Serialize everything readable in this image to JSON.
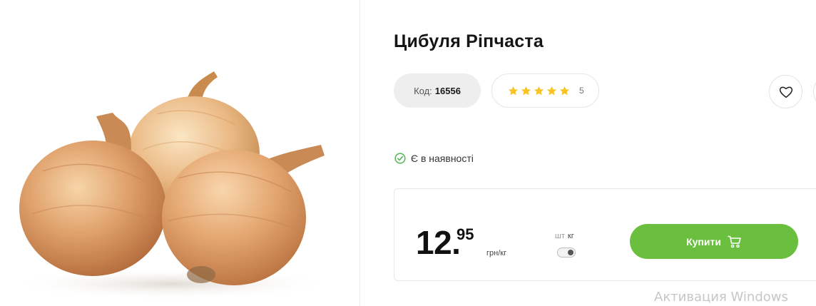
{
  "product": {
    "title": "Цибуля Ріпчаста",
    "image_alt": "onion-photo",
    "code_label": "Код:",
    "code_value": "16556",
    "rating": {
      "stars": 5,
      "max": 5,
      "count": "5"
    },
    "stock_text": "Є в наявності"
  },
  "price": {
    "integer": "12.",
    "decimal": "95",
    "unit": "грн/кг"
  },
  "unit_switch": {
    "option_pcs": "шт",
    "option_kg": "кг",
    "selected": "кг"
  },
  "actions": {
    "buy_label": "Купити"
  },
  "system": {
    "watermark": "Активация Windows"
  },
  "colors": {
    "accent_green": "#6bbf3e",
    "star_yellow": "#f7c325",
    "stock_green": "#5cb85c"
  },
  "icons": {
    "favorite": "heart-icon",
    "cart": "cart-icon",
    "stock": "check-circle-icon",
    "star": "star-icon"
  }
}
